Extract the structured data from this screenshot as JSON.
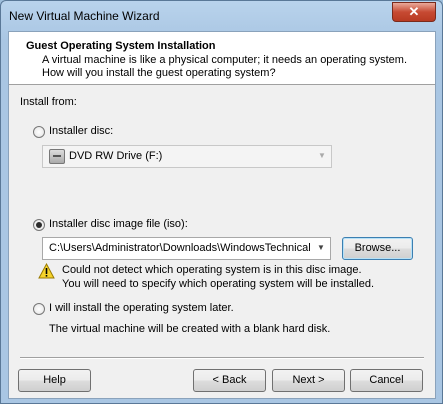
{
  "window": {
    "title": "New Virtual Machine Wizard",
    "close_glyph": "✕"
  },
  "header": {
    "title": "Guest Operating System Installation",
    "description": "A virtual machine is like a physical computer; it needs an operating system. How will you install the guest operating system?"
  },
  "install_from": {
    "label": "Install from:",
    "options": [
      {
        "label": "Installer disc:",
        "selected": false
      },
      {
        "label": "Installer disc image file (iso):",
        "selected": true
      },
      {
        "label": "I will install the operating system later.",
        "selected": false
      }
    ],
    "disc_drive": {
      "value": "DVD RW Drive (F:)",
      "icon": "dvd-drive-icon",
      "enabled": false
    },
    "iso_path": {
      "value": "C:\\Users\\Administrator\\Downloads\\WindowsTechnicalF"
    },
    "browse_label": "Browse...",
    "warning": {
      "icon": "warning-icon",
      "line1": "Could not detect which operating system is in this disc image.",
      "line2": "You will need to specify which operating system will be installed."
    },
    "later_note": "The virtual machine will be created with a blank hard disk."
  },
  "footer": {
    "help_label": "Help",
    "back_label": "< Back",
    "next_label": "Next >",
    "cancel_label": "Cancel"
  }
}
